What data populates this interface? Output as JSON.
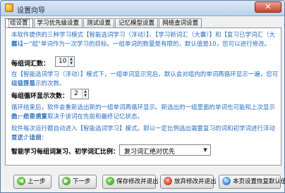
{
  "window": {
    "title": "设置向导",
    "close_icon": "close-x-icon"
  },
  "tabs": [
    {
      "label": "组设置",
      "active": true
    },
    {
      "label": "学习优先级设置",
      "active": false
    },
    {
      "label": "测试设置",
      "active": false
    },
    {
      "label": "记忆模型设置",
      "active": false
    },
    {
      "label": "网络查词设置",
      "active": false
    }
  ],
  "panel": {
    "intro_line1": "本软件提供的三种学习模式【智能选词学习（浮动）】、【学习新词汇（大囊）】和【复习已学词汇（大囊）】",
    "intro_line2": "都以一\"组\"单词作为一次学习的目标。一组单词的数量是有限的，默认值是10，您可以进行修改。",
    "words_per_group_label": "每组词汇数：",
    "words_per_group_value": "10",
    "smart_note_line1": "在【智能选词学习（浮动）】模式下，一组单词显示完后，默认会对组内的单词再循环显示一遍，您可以设置每",
    "smart_note_line2": "组循环显示的次数。",
    "loops_label": "每组循环显示次数：",
    "loops_value": "2",
    "loop_note_line1": "循环结束后，软件会重新选出新的一组单词再循环显示。新选出的一组里面的单词也可能和上次显示的一组单词重",
    "loop_note_line2": "叠，是否重复取决于该词在先前和最终记忆状态。",
    "ratio_note_line1": "软件每次运行都自动进入【智能选词学习】模式。即以一定比例选出需要复习的词和初学词进行浮动显示，请设",
    "ratio_note_line2": "置这个比例：",
    "ratio_label": "智能学习每组词复习、初学词汇比例：",
    "ratio_value": "复习词汇绝对优先"
  },
  "buttons": {
    "prev": "上一步",
    "next": "下一步",
    "save_exit": "保存修改并退出",
    "discard_exit": "放弃修改并退出",
    "reset_default": "本页设置恢复默认值"
  }
}
